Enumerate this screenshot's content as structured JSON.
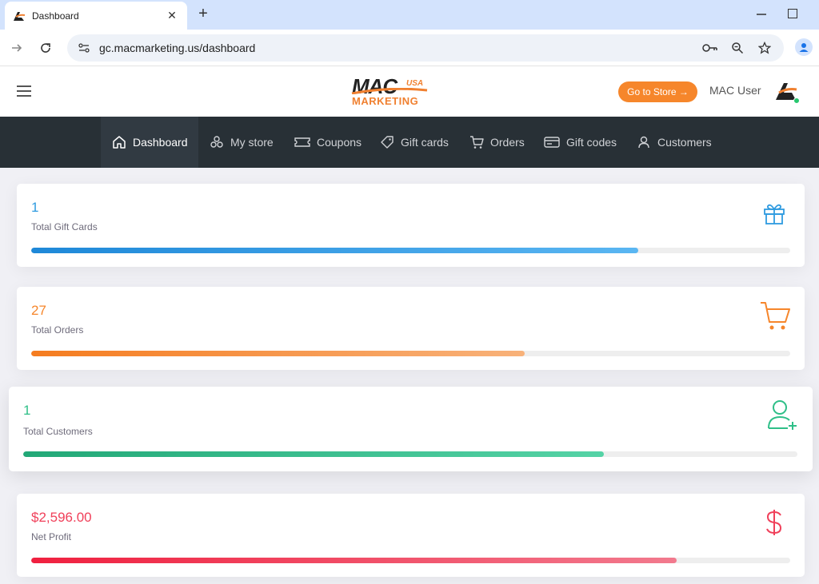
{
  "browser": {
    "tab_title": "Dashboard",
    "tab_close": "✕",
    "new_tab": "+",
    "url": "gc.macmarketing.us/dashboard"
  },
  "header": {
    "logo_mac": "MAC",
    "logo_usa": "USA",
    "logo_marketing": "MARKETING",
    "goto_store": "Go to Store →",
    "user_name": "MAC User"
  },
  "nav": {
    "items": [
      {
        "label": "Dashboard",
        "icon": "home-icon",
        "active": true
      },
      {
        "label": "My store",
        "icon": "store-icon",
        "active": false
      },
      {
        "label": "Coupons",
        "icon": "ticket-icon",
        "active": false
      },
      {
        "label": "Gift cards",
        "icon": "tag-icon",
        "active": false
      },
      {
        "label": "Orders",
        "icon": "cart-icon",
        "active": false
      },
      {
        "label": "Gift codes",
        "icon": "card-icon",
        "active": false
      },
      {
        "label": "Customers",
        "icon": "user-icon",
        "active": false
      }
    ]
  },
  "stats": [
    {
      "value": "1",
      "label": "Total Gift Cards",
      "icon": "gift-icon",
      "color": "#2f9be0",
      "progress": 0.8
    },
    {
      "value": "27",
      "label": "Total Orders",
      "icon": "shopping-cart-icon",
      "color": "#f6862b",
      "progress": 0.65
    },
    {
      "value": "1",
      "label": "Total Customers",
      "icon": "user-plus-icon",
      "color": "#2fbf88",
      "progress": 0.75
    },
    {
      "value": "$2,596.00",
      "label": "Net Profit",
      "icon": "dollar-icon",
      "color": "#f0405a",
      "progress": 0.85
    }
  ]
}
